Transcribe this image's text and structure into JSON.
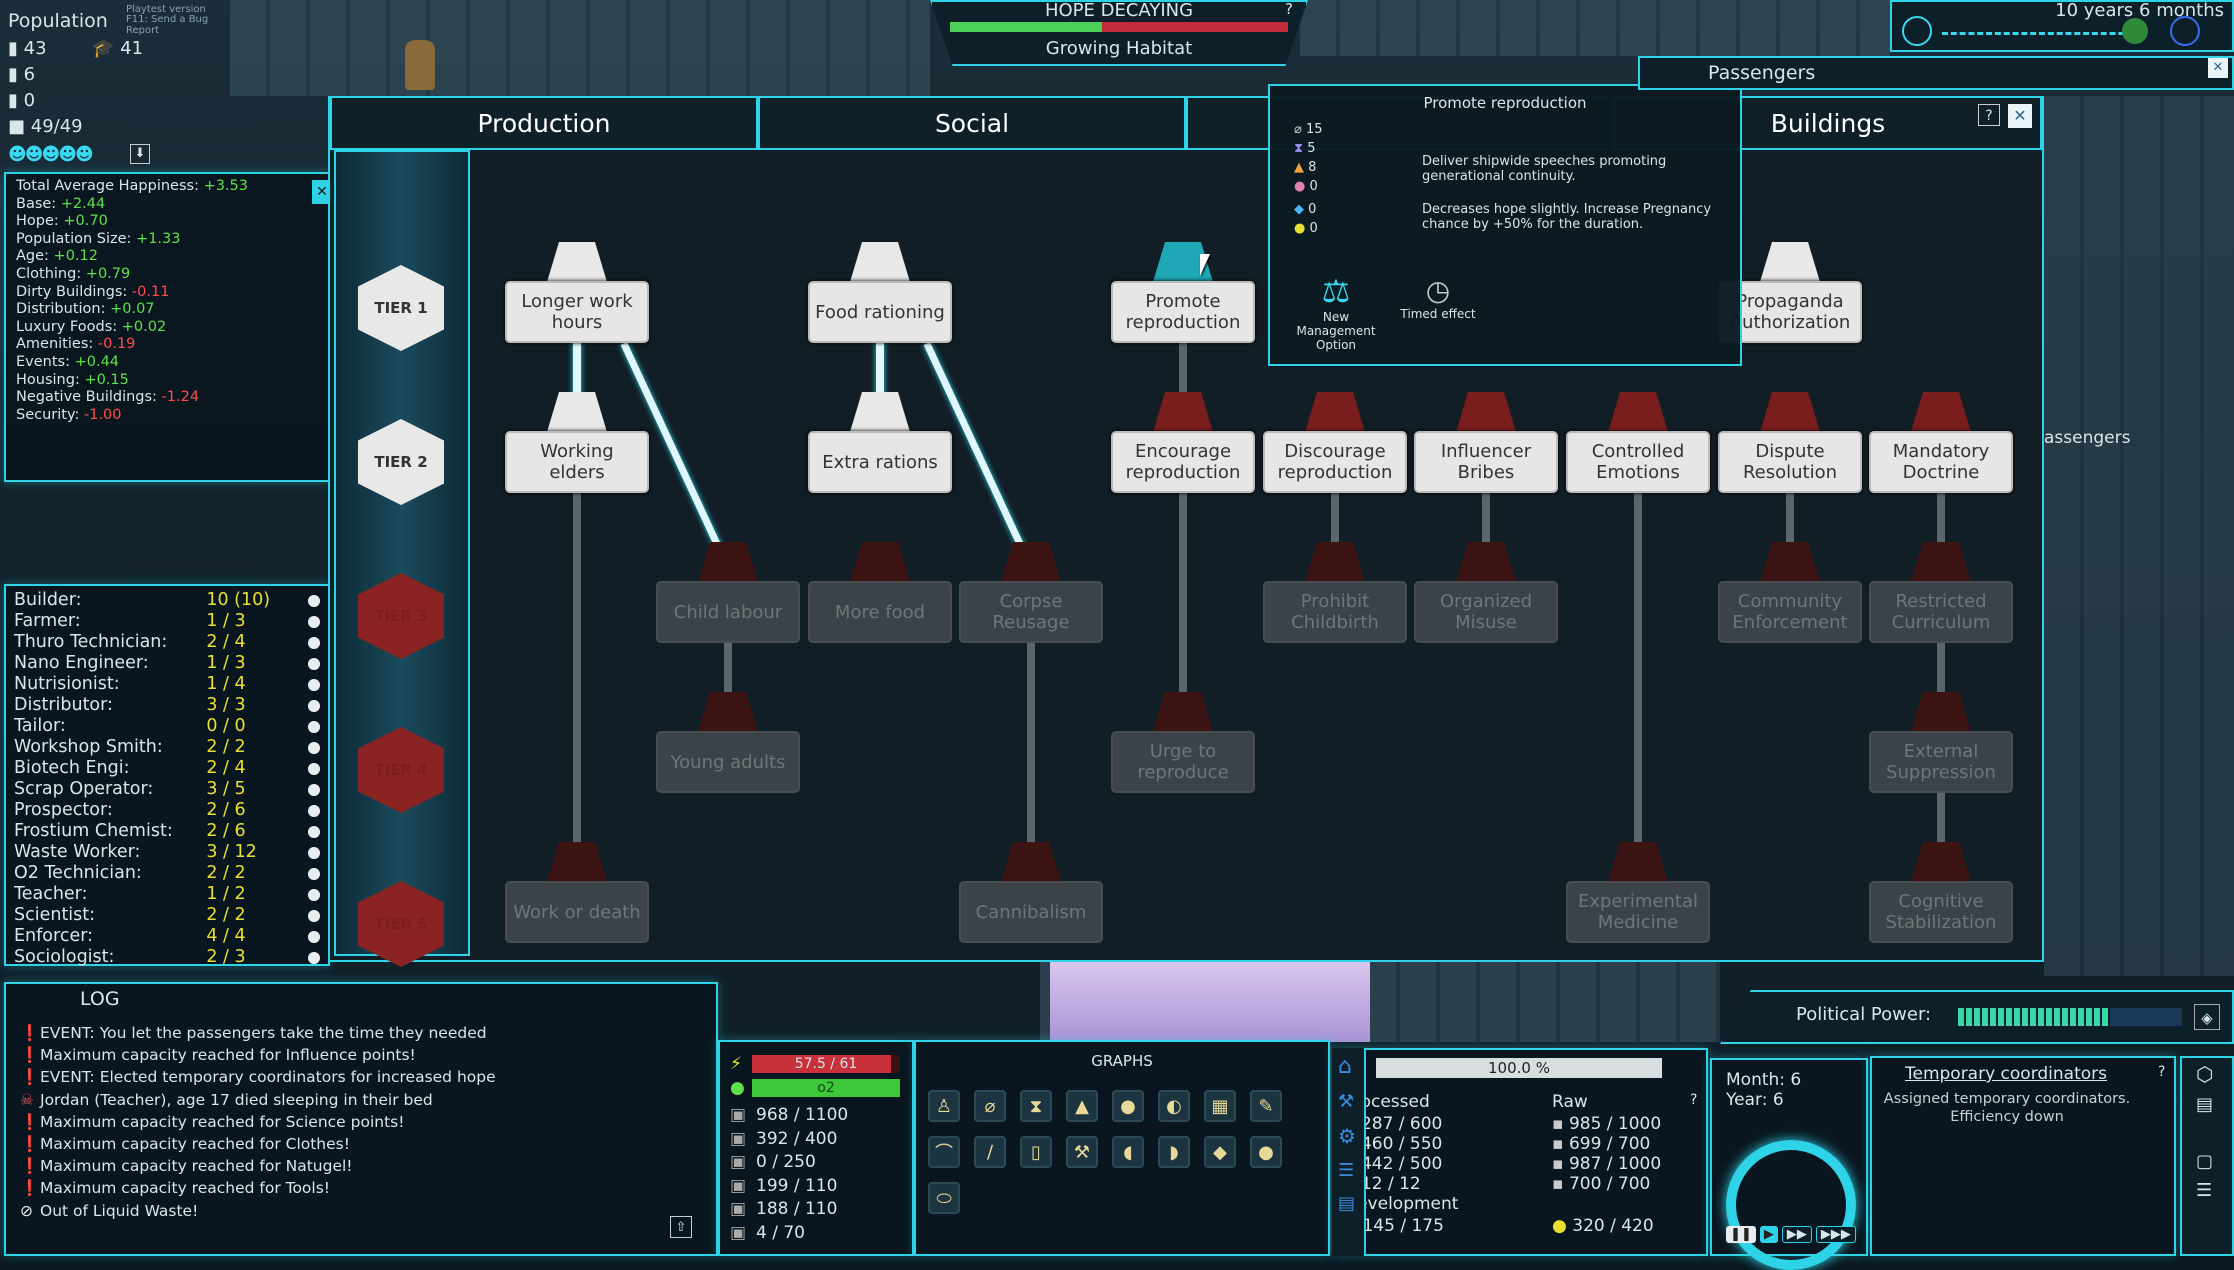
{
  "colors": {
    "accent": "#2fd3e8",
    "positive": "#5ee14a",
    "negative": "#ff4d4d",
    "value": "#e8e030"
  },
  "hud": {
    "population_label": "Population",
    "playtest": "Playtest version",
    "bug_report": "F11: Send a Bug Report",
    "pop_total": "43",
    "pop_students": "41",
    "pop_children": "6",
    "pop_elders": "0",
    "capacity": "49/49",
    "hope_status": "HOPE DECAYING",
    "hope_sub": "Growing Habitat",
    "hope_help": "?",
    "hope_level": 0.45,
    "time_elapsed": "10 years 6 months",
    "passengers_tab": "Passengers",
    "passengers_side": "assengers"
  },
  "happiness": {
    "total_label": "Total Average Happiness: ",
    "total": "+3.53",
    "rows": [
      {
        "label": "Base: ",
        "value": "+2.44",
        "tone": "pos"
      },
      {
        "label": "Hope: ",
        "value": "+0.70",
        "tone": "pos"
      },
      {
        "label": "Population Size: ",
        "value": "+1.33",
        "tone": "pos"
      },
      {
        "label": "Age: ",
        "value": "+0.12",
        "tone": "pos"
      },
      {
        "label": "Clothing: ",
        "value": "+0.79",
        "tone": "pos"
      },
      {
        "label": "Dirty Buildings: ",
        "value": "-0.11",
        "tone": "neg"
      },
      {
        "label": "Distribution: ",
        "value": "+0.07",
        "tone": "pos"
      },
      {
        "label": "Luxury Foods: ",
        "value": "+0.02",
        "tone": "pos"
      },
      {
        "label": "Amenities: ",
        "value": "-0.19",
        "tone": "neg"
      },
      {
        "label": "Events: ",
        "value": "+0.44",
        "tone": "pos"
      },
      {
        "label": "Housing: ",
        "value": "+0.15",
        "tone": "pos"
      },
      {
        "label": "Negative Buildings: ",
        "value": "-1.24",
        "tone": "neg"
      },
      {
        "label": "Security: ",
        "value": "-1.00",
        "tone": "neg"
      }
    ]
  },
  "jobs": [
    {
      "name": "Builder:",
      "value": "10 (10)"
    },
    {
      "name": "Farmer:",
      "value": "1 / 3"
    },
    {
      "name": "Thuro Technician:",
      "value": "2 / 4"
    },
    {
      "name": "Nano Engineer:",
      "value": "1 / 3"
    },
    {
      "name": "Nutrisionist:",
      "value": "1 / 4"
    },
    {
      "name": "Distributor:",
      "value": "3 / 3"
    },
    {
      "name": "Tailor:",
      "value": "0 / 0"
    },
    {
      "name": "Workshop Smith:",
      "value": "2 / 2"
    },
    {
      "name": "Biotech Engi:",
      "value": "2 / 4"
    },
    {
      "name": "Scrap Operator:",
      "value": "3 / 5"
    },
    {
      "name": "Prospector:",
      "value": "2 / 6"
    },
    {
      "name": "Frostium Chemist:",
      "value": "2 / 6"
    },
    {
      "name": "Waste Worker:",
      "value": "3 / 12"
    },
    {
      "name": "O2 Technician:",
      "value": "2 / 2"
    },
    {
      "name": "Teacher:",
      "value": "1 / 2"
    },
    {
      "name": "Scientist:",
      "value": "2 / 2"
    },
    {
      "name": "Enforcer:",
      "value": "4 / 4"
    },
    {
      "name": "Sociologist:",
      "value": "2 / 3"
    }
  ],
  "tabs": [
    "Production",
    "Social",
    "",
    "Buildings"
  ],
  "tabs_help": "?",
  "tiers": [
    "TIER 1",
    "TIER 2",
    "TIER 3",
    "TIER 4",
    "TIER 5"
  ],
  "nodes": {
    "longer_work": "Longer work hours",
    "food_rationing": "Food rationing",
    "promote_repro": "Promote reproduction",
    "propaganda": "Propaganda Authorization",
    "working_elders": "Working elders",
    "extra_rations": "Extra rations",
    "encourage_repro": "Encourage reproduction",
    "discourage_repro": "Discourage reproduction",
    "influencer_bribes": "Influencer Bribes",
    "controlled_emotions": "Controlled Emotions",
    "dispute_resolution": "Dispute Resolution",
    "mandatory_doctrine": "Mandatory Doctrine",
    "child_labour": "Child labour",
    "more_food": "More food",
    "corpse_reusage": "Corpse Reusage",
    "prohibit_childbirth": "Prohibit Childbirth",
    "organized_misuse": "Organized Misuse",
    "community_enforcement": "Community Enforcement",
    "restricted_curriculum": "Restricted Curriculum",
    "young_adults": "Young adults",
    "urge_reproduce": "Urge to reproduce",
    "external_suppression": "External Suppression",
    "work_or_death": "Work or death",
    "cannibalism": "Cannibalism",
    "experimental_medicine": "Experimental Medicine",
    "cognitive_stabilization": "Cognitive Stabilization"
  },
  "tooltip": {
    "title": "Promote reproduction",
    "costs": [
      "15",
      "5",
      "8",
      "0",
      "0",
      "0"
    ],
    "desc1": "Deliver shipwide speeches promoting generational continuity.",
    "desc2": "Decreases hope slightly. Increase Pregnancy chance by +50% for the duration.",
    "tag1": "New Management Option",
    "tag2": "Timed effect"
  },
  "log": {
    "title": "LOG",
    "entries": [
      "EVENT: You let the passengers take the time they needed",
      "Maximum capacity reached for Influence points!",
      "EVENT: Elected temporary coordinators for increased hope",
      "Jordan (Teacher), age 17 died sleeping in their bed",
      "Maximum capacity reached for Science points!",
      "Maximum capacity reached for Clothes!",
      "Maximum capacity reached for Natugel!",
      "Maximum capacity reached for Tools!",
      "Out of Liquid Waste!"
    ]
  },
  "resources": {
    "energy": "57.5 / 61",
    "energy_level": 0.94,
    "o2": "o2",
    "o2_level": 1.0,
    "rows": [
      "968 / 1100",
      "392 / 400",
      "0 / 250",
      "199 / 110",
      "188 / 110",
      "4 / 70"
    ]
  },
  "graphs": {
    "title": "GRAPHS"
  },
  "processing": {
    "percent": "100.0 %",
    "processed_label": "Processed",
    "raw_label": "Raw",
    "help": "?",
    "processed": [
      "287 / 600",
      "460 / 550",
      "442 / 500",
      "12 / 12"
    ],
    "raw": [
      "985 / 1000",
      "699 / 700",
      "987 / 1000",
      "700 / 700"
    ],
    "dev_label": "Development",
    "dev_a": "145 / 175",
    "dev_b": "320 / 420"
  },
  "date": {
    "month_label": "Month:",
    "month": "6",
    "year_label": "Year:",
    "year": "6"
  },
  "notice": {
    "title": "Temporary coordinators",
    "body": "Assigned temporary coordinators. Efficiency down",
    "help": "?"
  },
  "political": {
    "label": "Political Power:",
    "level": 0.68
  }
}
